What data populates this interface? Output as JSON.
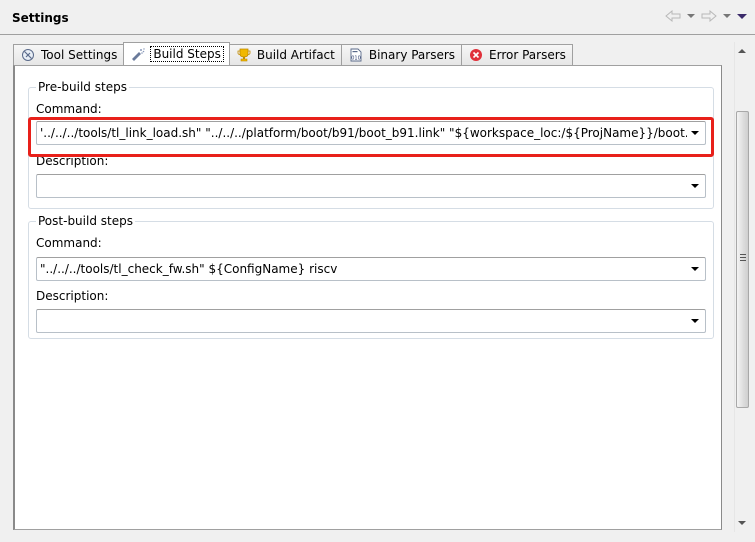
{
  "header": {
    "title": "Settings",
    "nav": {
      "back_icon": "back-arrow-icon",
      "back_menu_icon": "chevron-down-icon",
      "forward_icon": "forward-arrow-icon",
      "forward_menu_icon": "chevron-down-icon",
      "view_menu_icon": "view-menu-icon"
    }
  },
  "tabs": [
    {
      "label": "Tool Settings",
      "icon": "tool-settings-icon",
      "active": false
    },
    {
      "label": "Build Steps",
      "icon": "build-steps-icon",
      "active": true
    },
    {
      "label": "Build Artifact",
      "icon": "trophy-icon",
      "active": false
    },
    {
      "label": "Binary Parsers",
      "icon": "binary-file-icon",
      "active": false
    },
    {
      "label": "Error Parsers",
      "icon": "error-icon",
      "active": false
    }
  ],
  "pre_build": {
    "title": "Pre-build steps",
    "command_label": "Command:",
    "command_value": "'../../../tools/tl_link_load.sh\" \"../../../platform/boot/b91/boot_b91.link\" \"${workspace_loc:/${ProjName}}/boot.link\"",
    "description_label": "Description:",
    "description_value": ""
  },
  "post_build": {
    "title": "Post-build steps",
    "command_label": "Command:",
    "command_value": "\"../../../tools/tl_check_fw.sh\" ${ConfigName} riscv",
    "description_label": "Description:",
    "description_value": ""
  },
  "colors": {
    "highlight": "#e8201a",
    "background": "#f0f0f0",
    "panel": "#ffffff"
  }
}
